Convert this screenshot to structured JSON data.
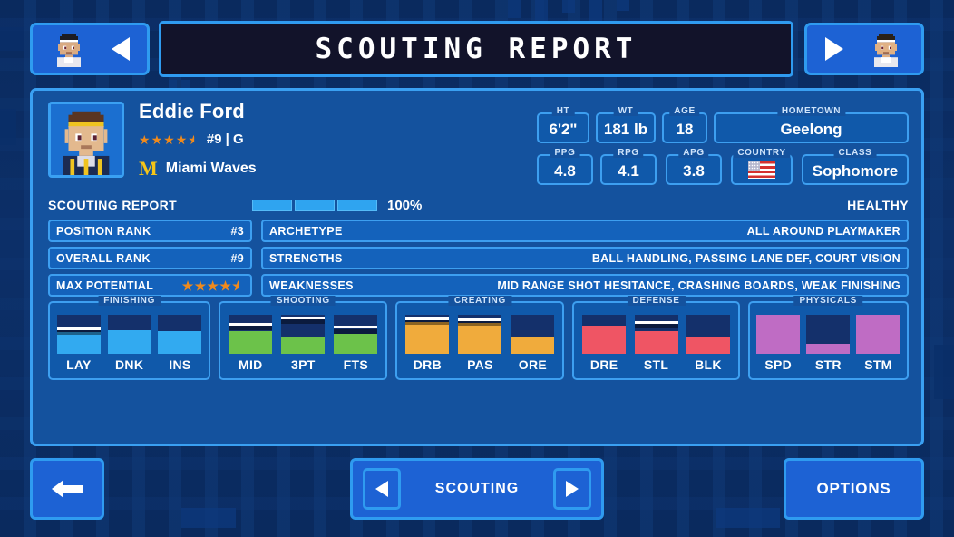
{
  "header": {
    "title": "SCOUTING REPORT",
    "prev_icon": "triangle-left-icon",
    "next_icon": "triangle-right-icon"
  },
  "player": {
    "name": "Eddie Ford",
    "rating_stars": 4.5,
    "jersey": "#9",
    "position": "G",
    "team_logo_letter": "M",
    "team": "Miami Waves",
    "avatar": "player-portrait"
  },
  "vitals": [
    {
      "label": "HT",
      "value": "6'2\""
    },
    {
      "label": "WT",
      "value": "181 lb"
    },
    {
      "label": "AGE",
      "value": "18"
    },
    {
      "label": "HOMETOWN",
      "value": "Geelong"
    },
    {
      "label": "PPG",
      "value": "4.8"
    },
    {
      "label": "RPG",
      "value": "4.1"
    },
    {
      "label": "APG",
      "value": "3.8"
    },
    {
      "label": "COUNTRY",
      "value": "usa-flag-icon"
    },
    {
      "label": "CLASS",
      "value": "Sophomore"
    }
  ],
  "scouting": {
    "section_label": "SCOUTING REPORT",
    "progress_pct": "100%",
    "progress_segments": 3,
    "progress_filled": 3,
    "status": "HEALTHY",
    "left_rows": [
      {
        "key": "POSITION RANK",
        "value": "#3"
      },
      {
        "key": "OVERALL RANK",
        "value": "#9"
      },
      {
        "key": "MAX POTENTIAL",
        "value": "",
        "stars": 4.5
      }
    ],
    "right_rows": [
      {
        "key": "ARCHETYPE",
        "value": "ALL AROUND PLAYMAKER"
      },
      {
        "key": "STRENGTHS",
        "value": "BALL HANDLING, PASSING LANE DEF, COURT VISION"
      },
      {
        "key": "WEAKNESSES",
        "value": "MID RANGE SHOT HESITANCE, CRASHING BOARDS, WEAK FINISHING"
      }
    ]
  },
  "attribute_groups": [
    {
      "title": "FINISHING",
      "color": "#32aaf0",
      "attrs": [
        {
          "label": "LAY",
          "fill": 55,
          "tick": 58
        },
        {
          "label": "DNK",
          "fill": 60,
          "tick": 62
        },
        {
          "label": "INS",
          "fill": 58,
          "tick": 0
        }
      ]
    },
    {
      "title": "SHOOTING",
      "color": "#66c councils"
    }
  ],
  "groups": [
    {
      "title": "FINISHING",
      "color": "#32aaf0",
      "attrs": [
        {
          "label": "LAY",
          "fill": 56,
          "tick": 60
        },
        {
          "label": "DNK",
          "fill": 60,
          "tick": 0
        },
        {
          "label": "INS",
          "fill": 58,
          "tick": 0
        }
      ]
    },
    {
      "title": "SHOOTING",
      "color": "#6cc24a",
      "attrs": [
        {
          "label": "MID",
          "fill": 58,
          "tick": 72
        },
        {
          "label": "3PT",
          "fill": 42,
          "tick": 88
        },
        {
          "label": "FTS",
          "fill": 52,
          "tick": 64
        }
      ]
    },
    {
      "title": "CREATING",
      "color": "#f0ab3c",
      "attrs": [
        {
          "label": "DRB",
          "fill": 82,
          "tick": 86
        },
        {
          "label": "PAS",
          "fill": 80,
          "tick": 84
        },
        {
          "label": "ORE",
          "fill": 42,
          "tick": 0
        }
      ]
    },
    {
      "title": "DEFENSE",
      "color": "#ef5564",
      "attrs": [
        {
          "label": "DRE",
          "fill": 72,
          "tick": 0
        },
        {
          "label": "STL",
          "fill": 58,
          "tick": 76
        },
        {
          "label": "BLK",
          "fill": 44,
          "tick": 0
        }
      ]
    },
    {
      "title": "PHYSICALS",
      "color": "#bf6cc4",
      "attrs": [
        {
          "label": "SPD",
          "fill": 100,
          "tick": 0
        },
        {
          "label": "STR",
          "fill": 26,
          "tick": 0
        },
        {
          "label": "STM",
          "fill": 100,
          "tick": 0
        }
      ]
    }
  ],
  "footer": {
    "back_icon": "arrow-left-icon",
    "pager_prev_icon": "triangle-left-icon",
    "pager_label": "SCOUTING",
    "pager_next_icon": "triangle-right-icon",
    "options_label": "OPTIONS"
  }
}
